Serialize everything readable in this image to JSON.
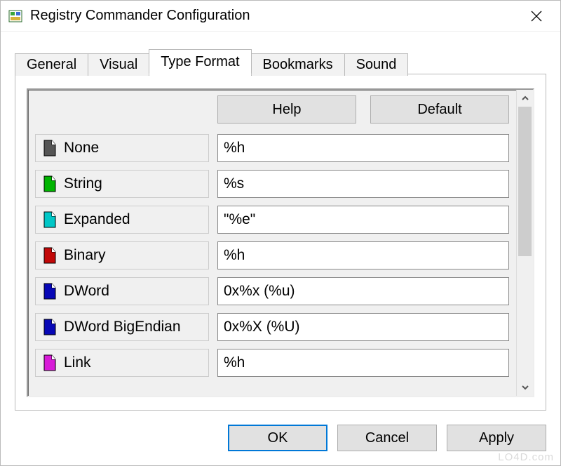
{
  "window": {
    "title": "Registry Commander Configuration"
  },
  "tabs": [
    {
      "label": "General"
    },
    {
      "label": "Visual"
    },
    {
      "label": "Type Format"
    },
    {
      "label": "Bookmarks"
    },
    {
      "label": "Sound"
    }
  ],
  "active_tab": 2,
  "toolbar": {
    "help_label": "Help",
    "default_label": "Default"
  },
  "rows": [
    {
      "name": "none",
      "label": "None",
      "value": "%h",
      "icon_fill": "#555555"
    },
    {
      "name": "string",
      "label": "String",
      "value": "%s",
      "icon_fill": "#00b400"
    },
    {
      "name": "expanded",
      "label": "Expanded",
      "value": "\"%e\"",
      "icon_fill": "#00c7c7"
    },
    {
      "name": "binary",
      "label": "Binary",
      "value": "%h",
      "icon_fill": "#c20808"
    },
    {
      "name": "dword",
      "label": "DWord",
      "value": "0x%x (%u)",
      "icon_fill": "#0707b6"
    },
    {
      "name": "dword-bigendian",
      "label": "DWord BigEndian",
      "value": "0x%X (%U)",
      "icon_fill": "#0707b6"
    },
    {
      "name": "link",
      "label": "Link",
      "value": "%h",
      "icon_fill": "#d81bd8"
    }
  ],
  "dialog": {
    "ok": "OK",
    "cancel": "Cancel",
    "apply": "Apply"
  },
  "watermark": "LO4D.com"
}
